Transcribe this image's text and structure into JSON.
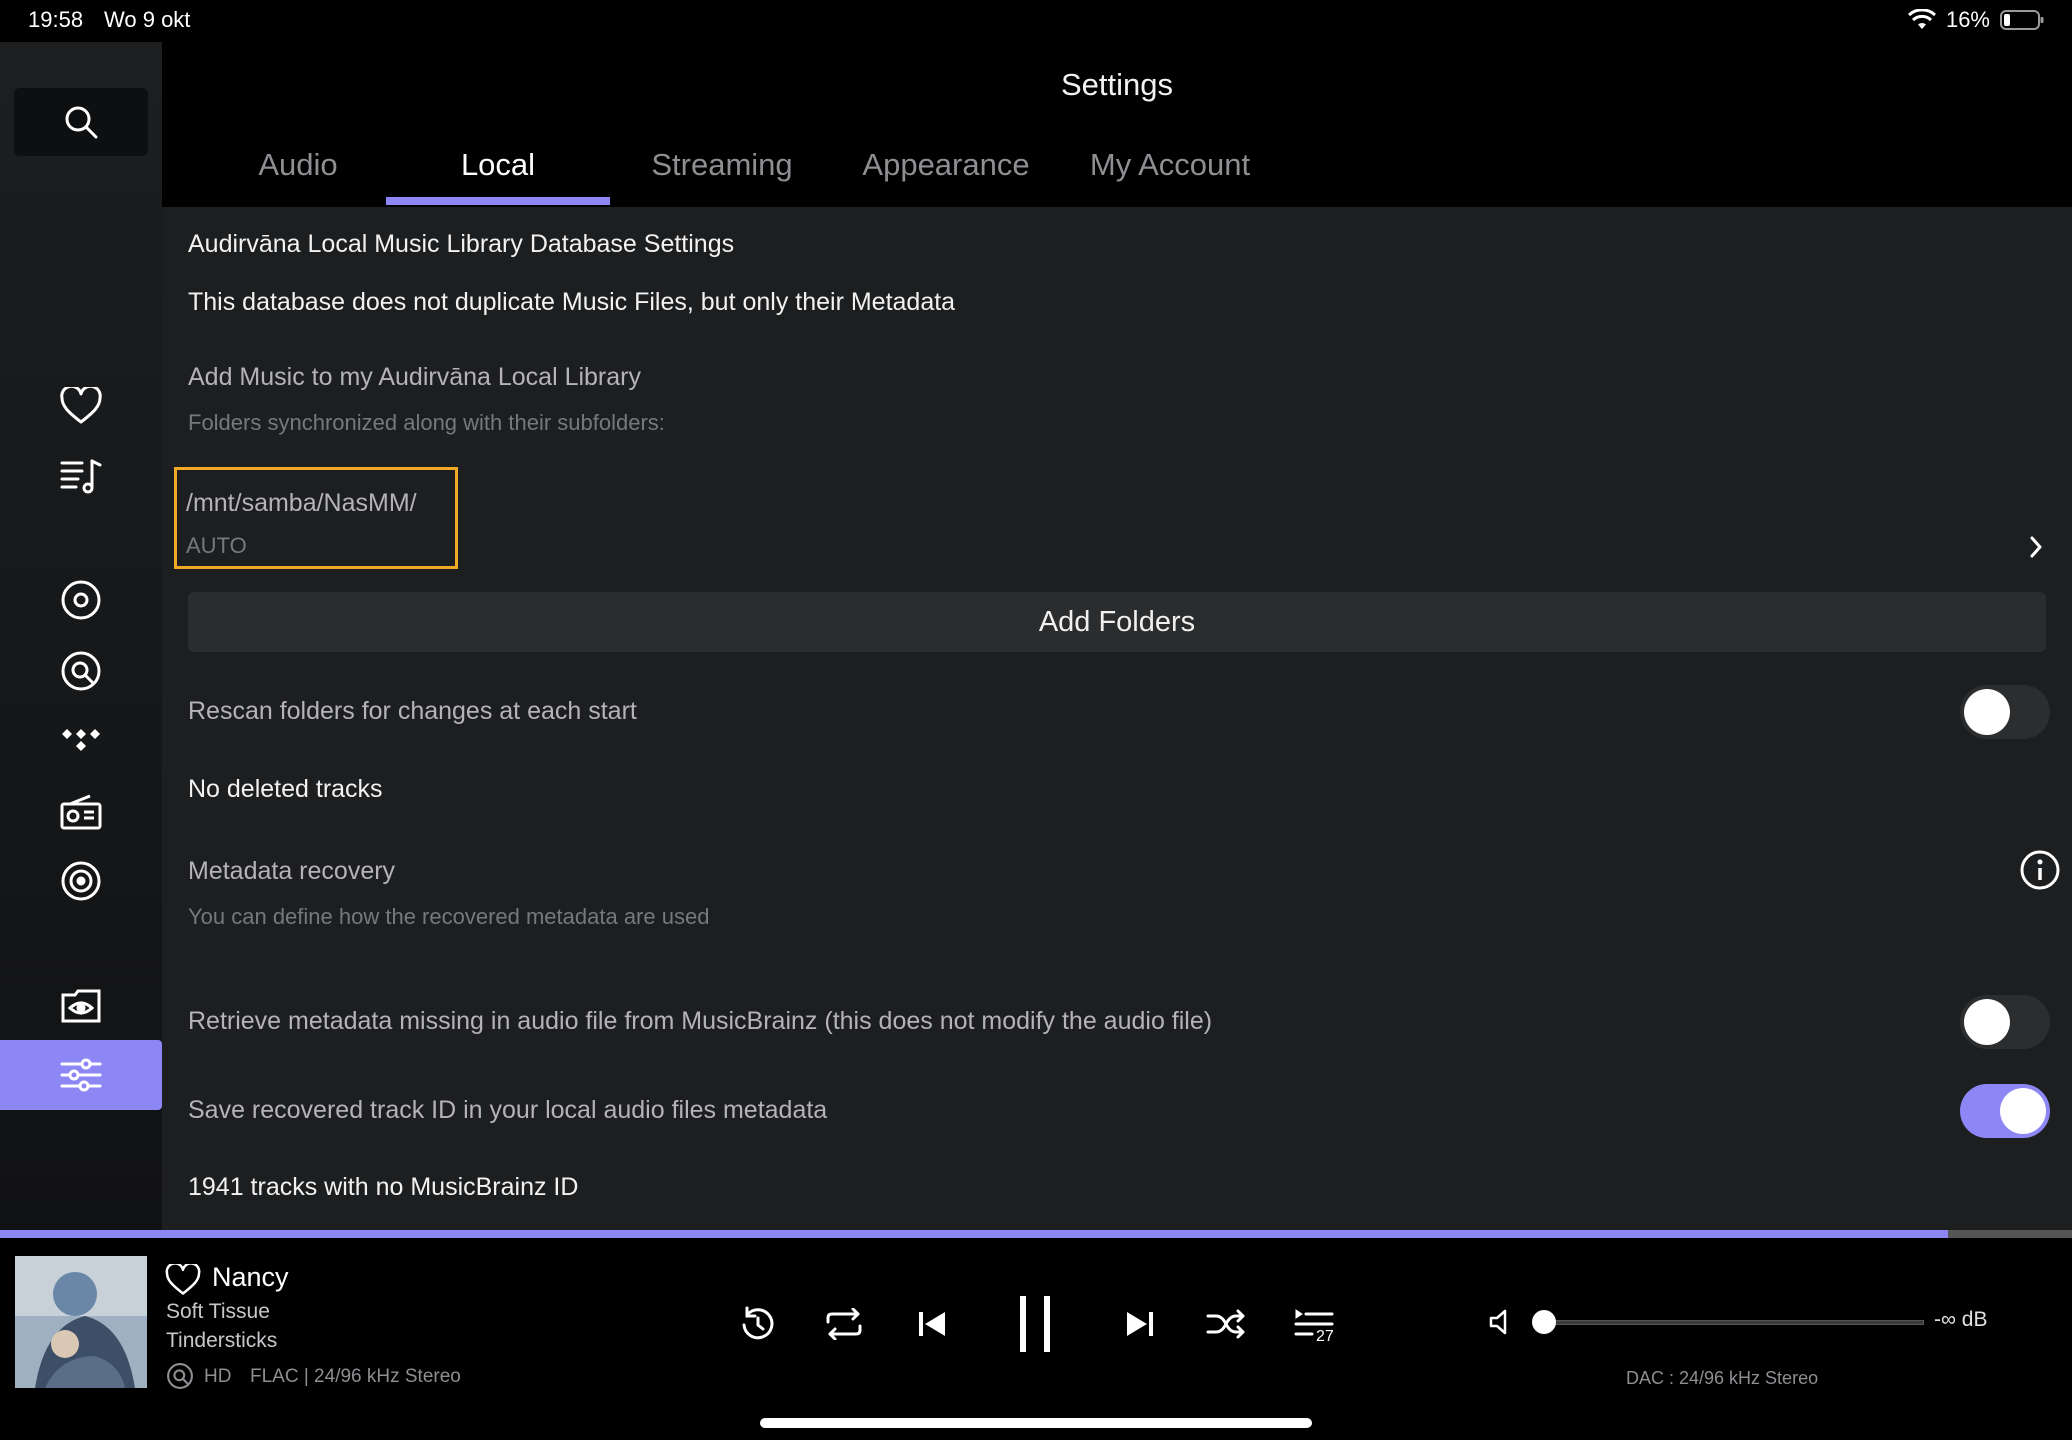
{
  "status": {
    "time": "19:58",
    "date": "Wo 9 okt",
    "battery": "16%"
  },
  "sidebar": {
    "items": [
      {
        "icon": "search-icon"
      },
      {
        "icon": "heart-icon"
      },
      {
        "icon": "playlist-icon"
      },
      {
        "icon": "local-disc-icon"
      },
      {
        "icon": "qobuz-icon"
      },
      {
        "icon": "tidal-icon"
      },
      {
        "icon": "radio-icon"
      },
      {
        "icon": "podcast-icon"
      },
      {
        "icon": "watch-folder-icon"
      },
      {
        "icon": "settings-sliders-icon"
      }
    ]
  },
  "header": {
    "title": "Settings",
    "tabs": [
      {
        "label": "Audio",
        "active": false
      },
      {
        "label": "Local",
        "active": true
      },
      {
        "label": "Streaming",
        "active": false
      },
      {
        "label": "Appearance",
        "active": false
      },
      {
        "label": "My Account",
        "active": false
      }
    ]
  },
  "local": {
    "db_title": "Audirvāna Local Music Library Database Settings",
    "db_desc": "This database does not duplicate Music Files, but only their Metadata",
    "add_music_title": "Add Music to my Audirvāna Local Library",
    "add_music_sub": "Folders synchronized along with their subfolders:",
    "folder_path": "/mnt/samba/NasMM/",
    "folder_mode": "AUTO",
    "add_folders_label": "Add Folders",
    "rescan_label": "Rescan folders for changes at each start",
    "rescan_on": false,
    "deleted_tracks": "No deleted tracks",
    "metadata_title": "Metadata recovery",
    "metadata_sub": "You can define how the recovered metadata are used",
    "retrieve_label": "Retrieve metadata missing in audio file from MusicBrainz (this does not modify the audio file)",
    "retrieve_on": false,
    "save_id_label": "Save recovered track ID in your local audio files metadata",
    "save_id_on": true,
    "no_mbid": "1941 tracks with no MusicBrainz ID"
  },
  "player": {
    "progress": 0.94,
    "title": "Nancy",
    "album": "Soft Tissue",
    "artist": "Tindersticks",
    "badge": "HD",
    "format": "FLAC | 24/96 kHz Stereo",
    "queue_count": "27",
    "volume_label": "-∞ dB",
    "dac": "DAC : 24/96 kHz Stereo"
  },
  "colors": {
    "accent": "#8d86f5",
    "highlight": "#f0a826",
    "panel": "#1c1e20"
  }
}
